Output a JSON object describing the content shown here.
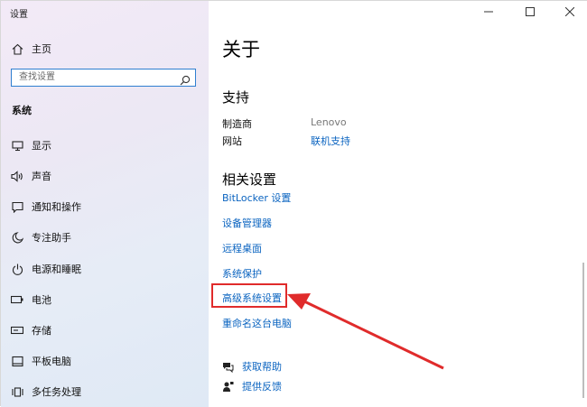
{
  "app_title": "设置",
  "sidebar": {
    "home_label": "主页",
    "search_placeholder": "查找设置",
    "section_title": "系统",
    "items": [
      {
        "label": "显示",
        "icon": "monitor-icon"
      },
      {
        "label": "声音",
        "icon": "speaker-icon"
      },
      {
        "label": "通知和操作",
        "icon": "message-icon"
      },
      {
        "label": "专注助手",
        "icon": "moon-icon"
      },
      {
        "label": "电源和睡眠",
        "icon": "power-icon"
      },
      {
        "label": "电池",
        "icon": "battery-icon"
      },
      {
        "label": "存储",
        "icon": "storage-icon"
      },
      {
        "label": "平板电脑",
        "icon": "tablet-icon"
      },
      {
        "label": "多任务处理",
        "icon": "multitask-icon"
      }
    ]
  },
  "window_controls": {
    "minimize": "—",
    "maximize": "☐",
    "close": "✕"
  },
  "main": {
    "page_title": "关于",
    "support": {
      "heading": "支持",
      "manufacturer_label": "制造商",
      "manufacturer_value": "Lenovo",
      "website_label": "网站",
      "website_link": "联机支持"
    },
    "related": {
      "heading": "相关设置",
      "links": [
        "BitLocker 设置",
        "设备管理器",
        "远程桌面",
        "系统保护",
        "高级系统设置",
        "重命名这台电脑"
      ]
    },
    "help": {
      "get_help": "获取帮助",
      "feedback": "提供反馈"
    }
  },
  "colors": {
    "link": "#0b64c0",
    "highlight": "#e02b2b",
    "accent": "#2f7fd0"
  }
}
